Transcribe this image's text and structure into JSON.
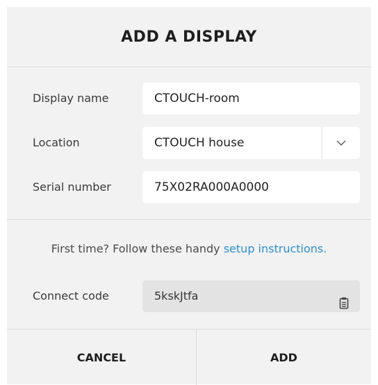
{
  "dialog": {
    "title": "ADD A DISPLAY"
  },
  "form": {
    "display_name": {
      "label": "Display name",
      "value": "CTOUCH-room"
    },
    "location": {
      "label": "Location",
      "value": "CTOUCH house"
    },
    "serial_number": {
      "label": "Serial number",
      "value": "75X02RA000A0000"
    }
  },
  "setup": {
    "hint_prefix": "First time? Follow these handy ",
    "link_text": "setup instructions."
  },
  "connect": {
    "label": "Connect code",
    "value": "5kskJtfa"
  },
  "footer": {
    "cancel_label": "CANCEL",
    "add_label": "ADD"
  },
  "colors": {
    "background": "#f2f2f2",
    "field": "#ffffff",
    "readonly_field": "#e3e3e3",
    "link": "#2a8fd0"
  },
  "icons": {
    "location_dropdown": "chevron-down-icon",
    "copy": "copy-icon"
  }
}
